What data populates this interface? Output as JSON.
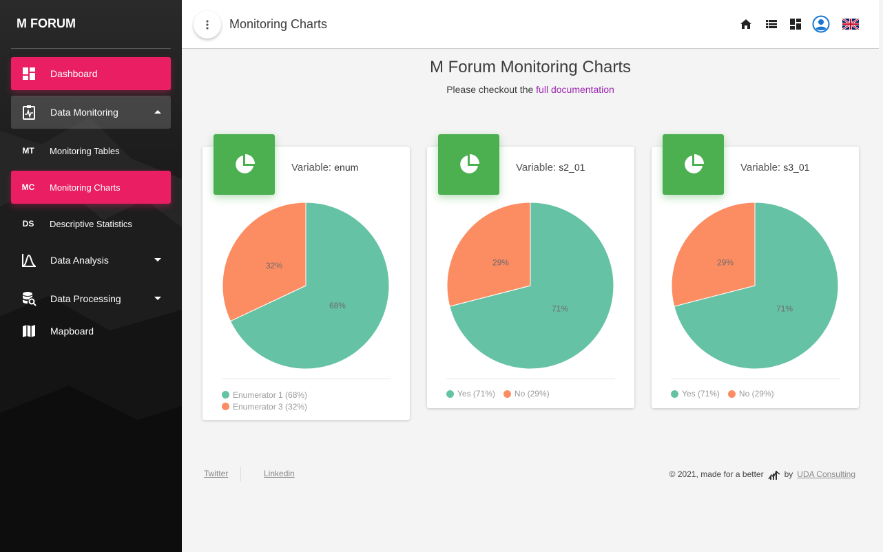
{
  "brand": "M FORUM",
  "sidebar": {
    "items": [
      {
        "label": "Dashboard"
      },
      {
        "label": "Data Monitoring"
      },
      {
        "abbr": "MT",
        "label": "Monitoring Tables"
      },
      {
        "abbr": "MC",
        "label": "Monitoring Charts"
      },
      {
        "abbr": "DS",
        "label": "Descriptive Statistics"
      },
      {
        "label": "Data Analysis"
      },
      {
        "label": "Data Processing"
      },
      {
        "label": "Mapboard"
      }
    ]
  },
  "topbar": {
    "title": "Monitoring Charts"
  },
  "page": {
    "heading": "M Forum Monitoring Charts",
    "subtitle_prefix": "Please checkout the ",
    "subtitle_link": "full documentation"
  },
  "colors": {
    "accent": "#e91e63",
    "card_icon": "#4caf50",
    "slice_green": "#66c2a5",
    "slice_orange": "#fc8d62"
  },
  "cards": [
    {
      "title_prefix": "Variable: ",
      "variable": "enum",
      "legend": [
        "Enumerator 1 (68%)",
        "Enumerator 3 (32%)"
      ],
      "pct_labels": [
        "68%",
        "32%"
      ]
    },
    {
      "title_prefix": "Variable: ",
      "variable": "s2_01",
      "legend": [
        "Yes (71%)",
        "No (29%)"
      ],
      "pct_labels": [
        "71%",
        "29%"
      ]
    },
    {
      "title_prefix": "Variable: ",
      "variable": "s3_01",
      "legend": [
        "Yes (71%)",
        "No (29%)"
      ],
      "pct_labels": [
        "71%",
        "29%"
      ]
    }
  ],
  "chart_data": [
    {
      "type": "pie",
      "categories": [
        "Enumerator 1",
        "Enumerator 3"
      ],
      "values": [
        68,
        32
      ]
    },
    {
      "type": "pie",
      "categories": [
        "Yes",
        "No"
      ],
      "values": [
        71,
        29
      ]
    },
    {
      "type": "pie",
      "categories": [
        "Yes",
        "No"
      ],
      "values": [
        71,
        29
      ]
    }
  ],
  "footer": {
    "links": [
      "Twitter",
      "Linkedin"
    ],
    "credit": "© 2021, made for a better",
    "by": "by",
    "company": "UDA Consulting"
  }
}
